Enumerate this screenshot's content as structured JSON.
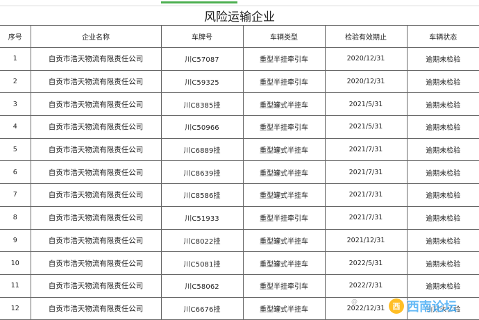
{
  "title": "风险运输企业",
  "headers": [
    "序号",
    "企业名称",
    "车牌号",
    "车辆类型",
    "检验有效期止",
    "车辆状态"
  ],
  "rows": [
    {
      "no": "1",
      "company": "自贡市浩天物流有限责任公司",
      "plate": "川C57087",
      "type": "重型半挂牵引车",
      "expiry": "2020/12/31",
      "status": "逾期未检验"
    },
    {
      "no": "2",
      "company": "自贡市浩天物流有限责任公司",
      "plate": "川C59325",
      "type": "重型半挂牵引车",
      "expiry": "2020/12/31",
      "status": "逾期未检验"
    },
    {
      "no": "3",
      "company": "自贡市浩天物流有限责任公司",
      "plate": "川C8385挂",
      "type": "重型罐式半挂车",
      "expiry": "2021/5/31",
      "status": "逾期未检验"
    },
    {
      "no": "4",
      "company": "自贡市浩天物流有限责任公司",
      "plate": "川C50966",
      "type": "重型半挂牵引车",
      "expiry": "2021/5/31",
      "status": "逾期未检验"
    },
    {
      "no": "5",
      "company": "自贡市浩天物流有限责任公司",
      "plate": "川C6889挂",
      "type": "重型罐式半挂车",
      "expiry": "2021/7/31",
      "status": "逾期未检验"
    },
    {
      "no": "6",
      "company": "自贡市浩天物流有限责任公司",
      "plate": "川C8639挂",
      "type": "重型罐式半挂车",
      "expiry": "2021/7/31",
      "status": "逾期未检验"
    },
    {
      "no": "7",
      "company": "自贡市浩天物流有限责任公司",
      "plate": "川C8586挂",
      "type": "重型罐式半挂车",
      "expiry": "2021/7/31",
      "status": "逾期未检验"
    },
    {
      "no": "8",
      "company": "自贡市浩天物流有限责任公司",
      "plate": "川C51933",
      "type": "重型半挂牵引车",
      "expiry": "2021/7/31",
      "status": "逾期未检验"
    },
    {
      "no": "9",
      "company": "自贡市浩天物流有限责任公司",
      "plate": "川C8022挂",
      "type": "重型罐式半挂车",
      "expiry": "2021/12/31",
      "status": "逾期未检验"
    },
    {
      "no": "10",
      "company": "自贡市浩天物流有限责任公司",
      "plate": "川C5081挂",
      "type": "重型罐式半挂车",
      "expiry": "2022/5/31",
      "status": "逾期未检验"
    },
    {
      "no": "11",
      "company": "自贡市浩天物流有限责任公司",
      "plate": "川C58062",
      "type": "重型半挂牵引车",
      "expiry": "2022/7/31",
      "status": "逾期未检验"
    },
    {
      "no": "12",
      "company": "自贡市浩天物流有限责任公司",
      "plate": "川C6676挂",
      "type": "重型罐式半挂车",
      "expiry": "2022/12/31",
      "status": "逾期未检验"
    }
  ],
  "watermark": {
    "text": "西南论坛",
    "logo": "西",
    "weibo": "@"
  }
}
